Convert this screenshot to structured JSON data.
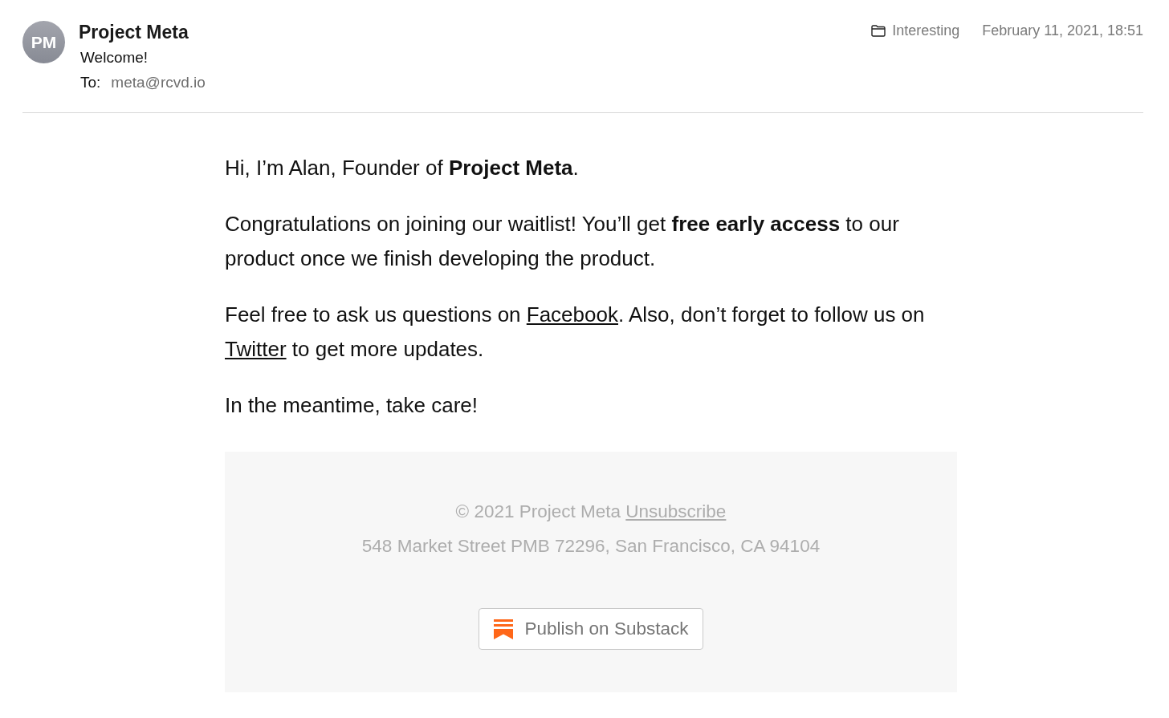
{
  "message": {
    "avatar": {
      "initials": "PM"
    },
    "sender": "Project Meta",
    "subject": "Welcome!",
    "to_label": "To:",
    "recipient": "meta@rcvd.io",
    "folder": "Interesting",
    "date": "February 11, 2021, 18:51"
  },
  "body": {
    "paragraphs": [
      {
        "parts": [
          {
            "kind": "text",
            "text": "Hi, I’m Alan, Founder of **Project Meta**."
          }
        ]
      },
      {
        "parts": [
          {
            "kind": "text",
            "text": "Congratulations on joining our waitlist! You’ll get **free early access** to our product once we finish developing the product."
          }
        ]
      },
      {
        "parts": [
          {
            "kind": "text",
            "text": "Feel free to ask us questions on "
          },
          {
            "kind": "link",
            "text": "Facebook"
          },
          {
            "kind": "text",
            "text": ". Also, don’t forget to follow us on "
          },
          {
            "kind": "link",
            "text": "Twitter"
          },
          {
            "kind": "text",
            "text": " to get more updates."
          }
        ]
      },
      {
        "parts": [
          {
            "kind": "text",
            "text": "In the meantime, take care!"
          }
        ]
      }
    ]
  },
  "footer": {
    "copyright": "© 2021 Project Meta",
    "unsubscribe": "Unsubscribe",
    "address": "548 Market Street PMB 72296, San Francisco, CA 94104",
    "publish_button": "Publish on Substack"
  }
}
